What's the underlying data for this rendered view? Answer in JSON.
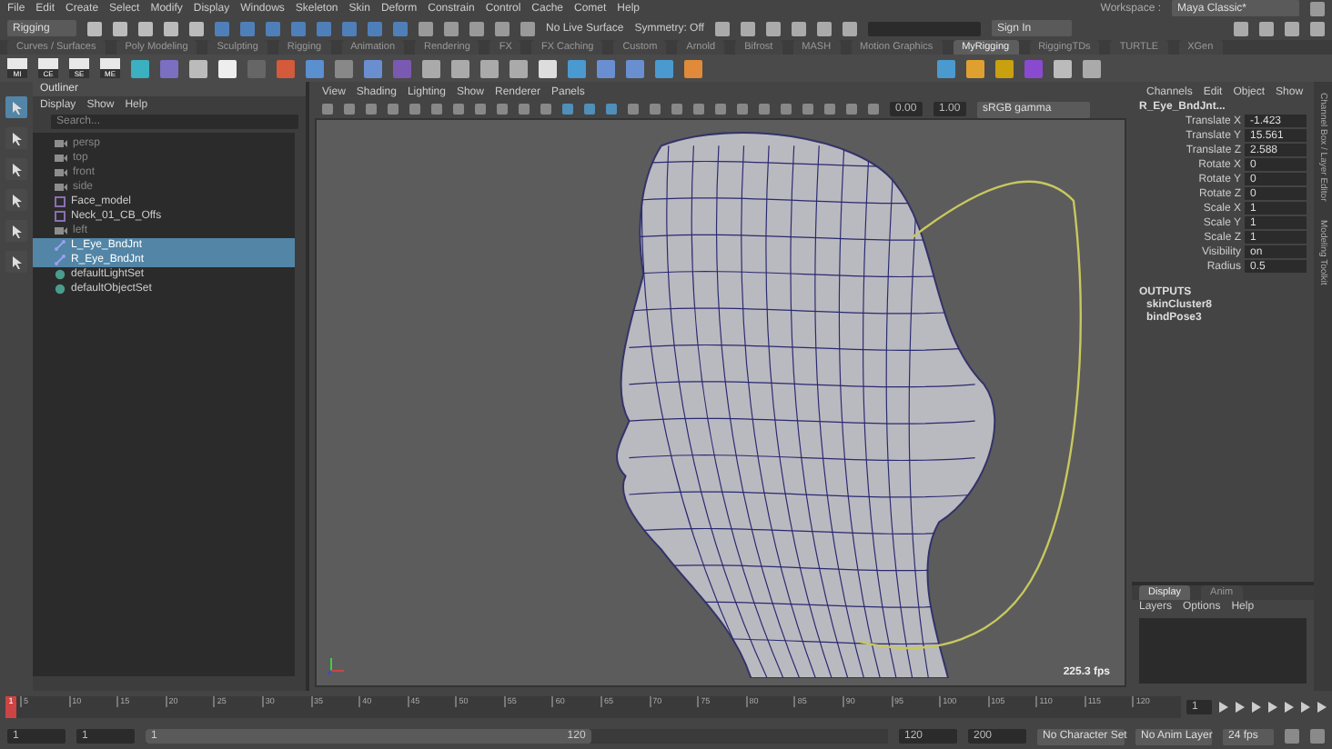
{
  "menu_bar": {
    "items": [
      "File",
      "Edit",
      "Create",
      "Select",
      "Modify",
      "Display",
      "Windows",
      "Skeleton",
      "Skin",
      "Deform",
      "Constrain",
      "Control",
      "Cache",
      "Comet",
      "Help"
    ],
    "workspace_label": "Workspace :",
    "workspace": "Maya Classic*"
  },
  "status_line": {
    "mode": "Rigging",
    "live_surface": "No Live Surface",
    "symmetry": "Symmetry: Off",
    "sign_in": "Sign In"
  },
  "shelf": {
    "tabs": [
      {
        "label": "Curves / Surfaces",
        "selected": false
      },
      {
        "label": "Poly Modeling",
        "selected": false
      },
      {
        "label": "Sculpting",
        "selected": false
      },
      {
        "label": "Rigging",
        "selected": false
      },
      {
        "label": "Animation",
        "selected": false
      },
      {
        "label": "Rendering",
        "selected": false
      },
      {
        "label": "FX",
        "selected": false
      },
      {
        "label": "FX Caching",
        "selected": false
      },
      {
        "label": "Custom",
        "selected": false
      },
      {
        "label": "Arnold",
        "selected": false
      },
      {
        "label": "Bifrost",
        "selected": false
      },
      {
        "label": "MASH",
        "selected": false
      },
      {
        "label": "Motion Graphics",
        "selected": false
      },
      {
        "label": "MyRigging",
        "selected": true
      },
      {
        "label": "RiggingTDs",
        "selected": false
      },
      {
        "label": "TURTLE",
        "selected": false
      },
      {
        "label": "XGen",
        "selected": false
      }
    ],
    "buttons": [
      "MI",
      "CE",
      "SE",
      "ME"
    ]
  },
  "toolbox": {
    "tools": [
      {
        "selected": true
      },
      {
        "selected": false
      },
      {
        "selected": false
      },
      {
        "selected": false
      },
      {
        "selected": false
      },
      {
        "selected": false
      }
    ]
  },
  "outliner": {
    "title": "Outliner",
    "menu": [
      "Display",
      "Show",
      "Help"
    ],
    "search": {
      "placeholder": "Search..."
    },
    "items": [
      {
        "label": "persp",
        "kind": "camera",
        "selected": false,
        "dimmed": true
      },
      {
        "label": "top",
        "kind": "camera",
        "selected": false,
        "dimmed": true
      },
      {
        "label": "front",
        "kind": "camera",
        "selected": false,
        "dimmed": true
      },
      {
        "label": "side",
        "kind": "camera",
        "selected": false,
        "dimmed": true
      },
      {
        "label": "Face_model",
        "kind": "mesh",
        "selected": false,
        "dimmed": false
      },
      {
        "label": "Neck_01_CB_Offs",
        "kind": "mesh",
        "selected": false,
        "dimmed": false
      },
      {
        "label": "left",
        "kind": "camera",
        "selected": false,
        "dimmed": true
      },
      {
        "label": "L_Eye_BndJnt",
        "kind": "joint",
        "selected": true,
        "dimmed": false
      },
      {
        "label": "R_Eye_BndJnt",
        "kind": "joint",
        "selected": true,
        "dimmed": false
      },
      {
        "label": "defaultLightSet",
        "kind": "set",
        "selected": false,
        "dimmed": false
      },
      {
        "label": "defaultObjectSet",
        "kind": "set",
        "selected": false,
        "dimmed": false
      }
    ]
  },
  "viewport": {
    "menu": [
      "View",
      "Shading",
      "Lighting",
      "Show",
      "Renderer",
      "Panels"
    ],
    "fields": [
      "0.00",
      "1.00"
    ],
    "color_space": "sRGB gamma",
    "fps": "225.3 fps"
  },
  "channel_box": {
    "menu": [
      "Channels",
      "Edit",
      "Object",
      "Show"
    ],
    "node": "R_Eye_BndJnt...",
    "attributes": [
      {
        "name": "Translate X",
        "value": "-1.423"
      },
      {
        "name": "Translate Y",
        "value": "15.561"
      },
      {
        "name": "Translate Z",
        "value": "2.588"
      },
      {
        "name": "Rotate X",
        "value": "0"
      },
      {
        "name": "Rotate Y",
        "value": "0"
      },
      {
        "name": "Rotate Z",
        "value": "0"
      },
      {
        "name": "Scale X",
        "value": "1"
      },
      {
        "name": "Scale Y",
        "value": "1"
      },
      {
        "name": "Scale Z",
        "value": "1"
      },
      {
        "name": "Visibility",
        "value": "on"
      },
      {
        "name": "Radius",
        "value": "0.5"
      }
    ],
    "outputs_label": "OUTPUTS",
    "outputs": [
      "skinCluster8",
      "bindPose3"
    ]
  },
  "side_tabs": [
    "Channel Box / Layer Editor",
    "Modeling Toolkit"
  ],
  "layer_editor": {
    "tabs": [
      {
        "label": "Display",
        "selected": true
      },
      {
        "label": "Anim",
        "selected": false
      }
    ],
    "menu": [
      "Layers",
      "Options",
      "Help"
    ]
  },
  "time_slider": {
    "marker": "1",
    "level": 0,
    "ticks": [
      "5",
      "10",
      "15",
      "20",
      "25",
      "30",
      "35",
      "40",
      "45",
      "50",
      "55",
      "60",
      "65",
      "70",
      "75",
      "80",
      "85",
      "90",
      "95",
      "100",
      "105",
      "110",
      "115",
      "120"
    ],
    "current_frame": "1"
  },
  "range_slider": {
    "level": 0.6,
    "start": "1",
    "current": "1",
    "range_start": "1",
    "range_end": "120",
    "end": "120",
    "max": "200",
    "character_set": "No Character Set",
    "anim_layer": "No Anim Layer",
    "fps": "24 fps"
  }
}
